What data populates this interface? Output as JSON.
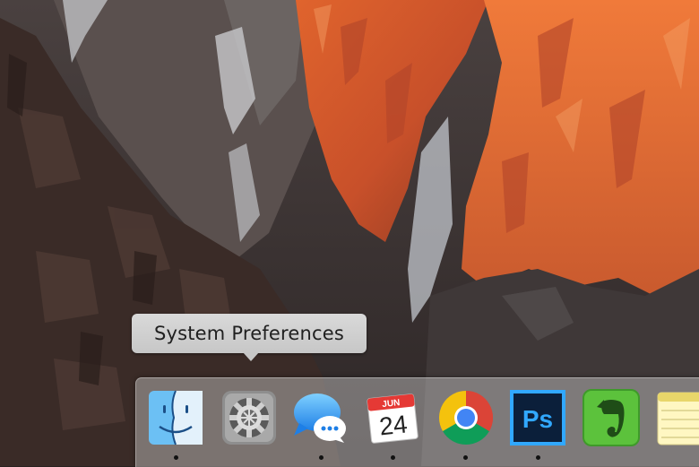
{
  "tooltip": {
    "text": "System Preferences"
  },
  "calendar": {
    "month": "JUN",
    "day": "24"
  },
  "photoshop": {
    "label": "Ps"
  },
  "dock": {
    "items": [
      {
        "name": "Finder",
        "icon": "finder-icon",
        "running": true
      },
      {
        "name": "System Preferences",
        "icon": "gear-icon",
        "running": false
      },
      {
        "name": "Messages",
        "icon": "messages-icon",
        "running": true
      },
      {
        "name": "Calendar",
        "icon": "calendar-icon",
        "running": true
      },
      {
        "name": "Google Chrome",
        "icon": "chrome-icon",
        "running": true
      },
      {
        "name": "Photoshop",
        "icon": "photoshop-icon",
        "running": true
      },
      {
        "name": "Evernote",
        "icon": "evernote-icon",
        "running": false
      },
      {
        "name": "Notes",
        "icon": "notes-icon",
        "running": false
      }
    ]
  },
  "colors": {
    "tooltip_bg": "#d2d2d2",
    "photoshop_blue": "#31a8ff",
    "evernote_green": "#5cc23c",
    "chrome_red": "#db4437",
    "chrome_yellow": "#f4c20d",
    "chrome_green": "#0f9d58",
    "chrome_blue": "#4285f4"
  }
}
